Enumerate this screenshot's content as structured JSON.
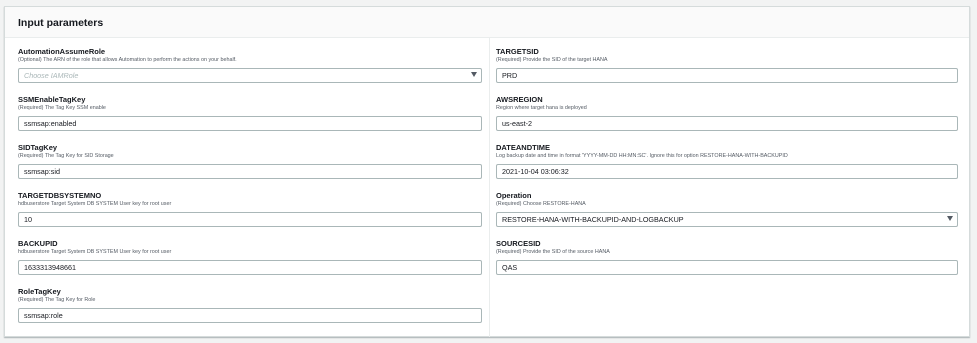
{
  "panel": {
    "title": "Input parameters"
  },
  "left": [
    {
      "label": "AutomationAssumeRole",
      "description": "(Optional) The ARN of the role that allows Automation to perform the actions on your behalf.",
      "placeholder": "Choose IAMRole",
      "value": "",
      "type": "select"
    },
    {
      "label": "SSMEnableTagKey",
      "description": "(Required) The Tag Key SSM enable",
      "value": "ssmsap:enabled",
      "type": "text"
    },
    {
      "label": "SIDTagKey",
      "description": "(Required) The Tag Key for SID Storage",
      "value": "ssmsap:sid",
      "type": "text"
    },
    {
      "label": "TARGETDBSYSTEMNO",
      "description": "hdbuserstore Target System DB SYSTEM User key for root user",
      "value": "10",
      "type": "text"
    },
    {
      "label": "BACKUPID",
      "description": "hdbuserstore Target System DB SYSTEM User key for root user",
      "value": "1633313948661",
      "type": "text"
    },
    {
      "label": "RoleTagKey",
      "description": "(Required) The Tag Key for Role",
      "value": "ssmsap:role",
      "type": "text"
    }
  ],
  "right": [
    {
      "label": "TARGETSID",
      "description": "(Required) Provide the SID of the target HANA",
      "value": "PRD",
      "type": "text"
    },
    {
      "label": "AWSREGION",
      "description": "Region where target hana is deployed",
      "value": "us-east-2",
      "type": "text"
    },
    {
      "label": "DATEANDTIME",
      "description": "Log backup date and time in format 'YYYY-MM-DD HH:MN:SC'. Ignore this for option RESTORE-HANA-WITH-BACKUPID",
      "value": "2021-10-04 03:06:32",
      "type": "text"
    },
    {
      "label": "Operation",
      "description": "(Required) Choose RESTORE-HANA",
      "value": "RESTORE-HANA-WITH-BACKUPID-AND-LOGBACKUP",
      "type": "select"
    },
    {
      "label": "SOURCESID",
      "description": "(Required) Provide the SID of the source HANA",
      "value": "QAS",
      "type": "text"
    }
  ]
}
